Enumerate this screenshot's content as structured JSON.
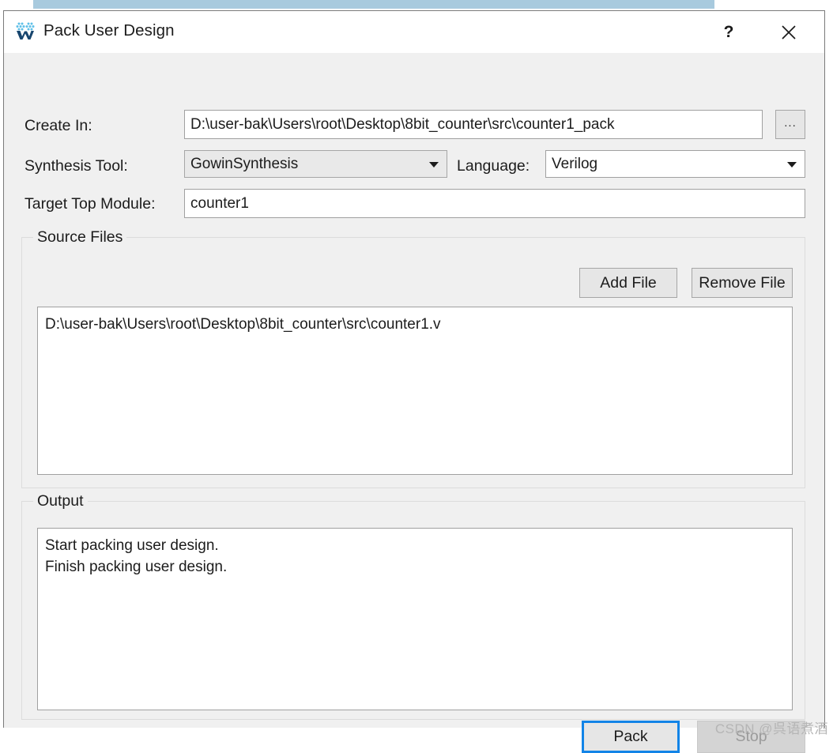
{
  "window": {
    "title": "Pack User Design",
    "icon": "gowin-logo-icon",
    "help_label": "?",
    "close_label": "✕"
  },
  "form": {
    "create_in": {
      "label": "Create In:",
      "value": "D:\\user-bak\\Users\\root\\Desktop\\8bit_counter\\src\\counter1_pack",
      "browse_label": "..."
    },
    "synthesis_tool": {
      "label": "Synthesis Tool:",
      "value": "GowinSynthesis"
    },
    "language": {
      "label": "Language:",
      "value": "Verilog"
    },
    "target_top_module": {
      "label": "Target Top Module:",
      "value": "counter1"
    }
  },
  "source_files": {
    "title": "Source Files",
    "add_label": "Add File",
    "remove_label": "Remove File",
    "files": [
      "D:\\user-bak\\Users\\root\\Desktop\\8bit_counter\\src\\counter1.v"
    ]
  },
  "output": {
    "title": "Output",
    "lines": [
      "Start packing user design.",
      "Finish packing user design."
    ]
  },
  "actions": {
    "pack_label": "Pack",
    "stop_label": "Stop"
  },
  "watermark": "CSDN @呉语煮酒",
  "colors": {
    "dialog_bg": "#f0f0f0",
    "focus_border": "#1284e7",
    "selection_blue": "#a8cade",
    "disabled_text": "#9a9a9a"
  }
}
